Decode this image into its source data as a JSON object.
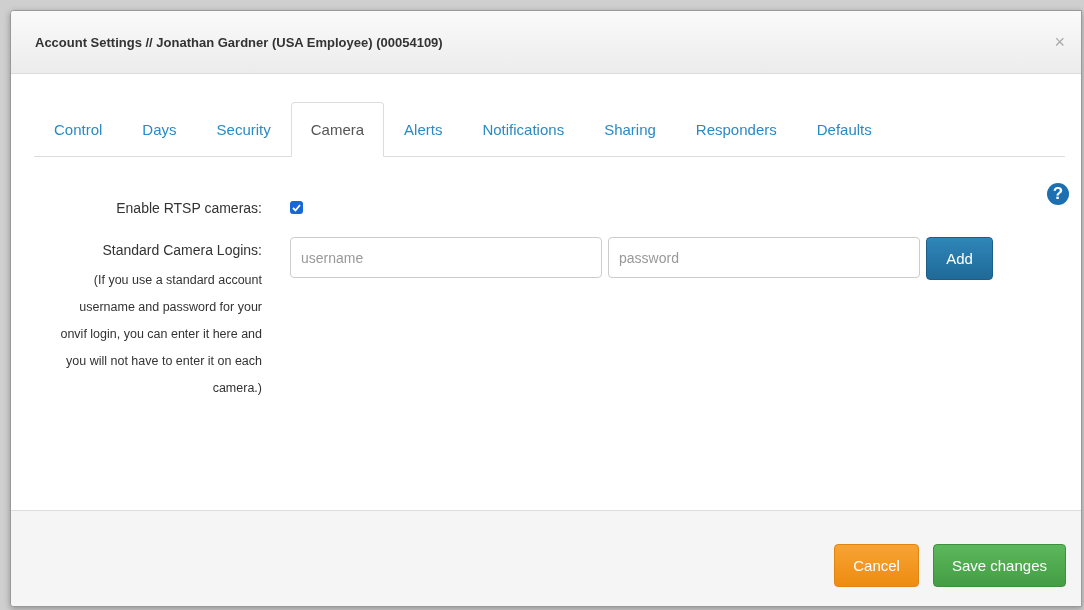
{
  "dialog": {
    "title": "Account Settings // Jonathan Gardner (USA Employee) (00054109)",
    "close": "×"
  },
  "tabs": [
    {
      "label": "Control",
      "selected": false
    },
    {
      "label": "Days",
      "selected": false
    },
    {
      "label": "Security",
      "selected": false
    },
    {
      "label": "Camera",
      "selected": true
    },
    {
      "label": "Alerts",
      "selected": false
    },
    {
      "label": "Notifications",
      "selected": false
    },
    {
      "label": "Sharing",
      "selected": false
    },
    {
      "label": "Responders",
      "selected": false
    },
    {
      "label": "Defaults",
      "selected": false
    }
  ],
  "help": "?",
  "rows": [
    {
      "kind": "checkbox",
      "label": "Enable RTSP cameras:",
      "checked": true
    },
    {
      "kind": "login",
      "label": "Standard Camera Logins:",
      "fields": [
        {
          "placeholder": "username"
        },
        {
          "placeholder": "password"
        }
      ],
      "button": "Add",
      "note": "(If you use a standard account username and password for your onvif login, you can enter it here and you will not have to enter it on each camera.)"
    }
  ],
  "footer": {
    "buttons": [
      {
        "label": "Cancel",
        "kind": "warning"
      },
      {
        "label": "Save changes",
        "kind": "success"
      }
    ]
  }
}
